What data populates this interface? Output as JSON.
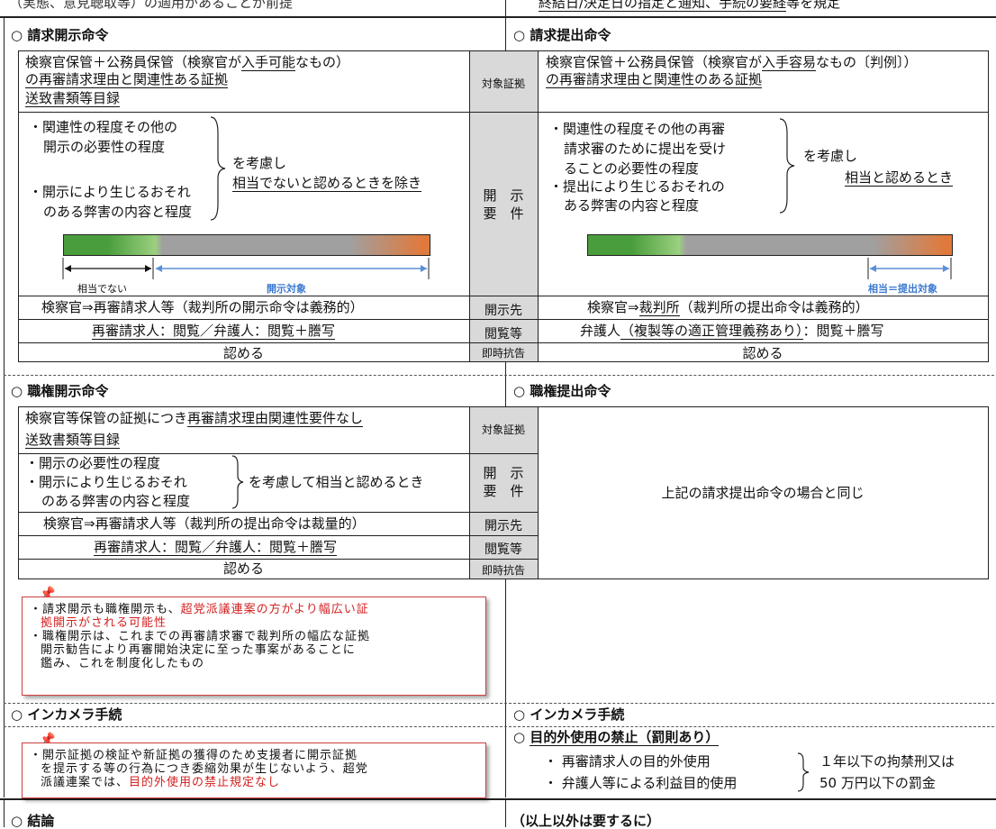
{
  "top_strip": {
    "left": "（実態、意見聴取等）の適用があることが前提",
    "right_a": "終結日/決定日の指定と通知、",
    "right_b": "手続の要経",
    "right_c": "等を規定"
  },
  "sections": {
    "req_disclosure": "請求開示命令",
    "req_submission": "請求提出命令",
    "auth_disclosure": "職権開示命令",
    "auth_submission": "職権提出命令",
    "incamera_left": "インカメラ手続",
    "incamera_right": "インカメラ手続",
    "prohibition": "目的外使用の禁止（罰則あり）",
    "bottom_left": "結論",
    "bottom_right": "（以上以外は要するに）"
  },
  "row_labels": {
    "target": "対象証拠",
    "req_a": "開　示",
    "req_b": "要　件",
    "to": "開示先",
    "view": "閲覧等",
    "appeal": "即時抗告"
  },
  "req_disc": {
    "target_1a": "検察官保管＋公務員保管（検察官が",
    "target_1b": "入手可能",
    "target_1c": "なもの）",
    "target_2": "の再審請求理由と関連性ある証拠",
    "target_3": "送致書類等目録",
    "cond_1": "・関連性の程度その他の",
    "cond_2": "開示の必要性の程度",
    "cond_3": "・開示により生じるおそれ",
    "cond_4": "のある弊害の内容と程度",
    "consider": "を考慮し",
    "except": "相当でないと認めるときを除き",
    "bar_left": "相当でない",
    "bar_right": "開示対象",
    "to": "検察官⇒再審請求人等（裁判所の開示命令は義務的）",
    "view_a": "再審請求人：閲覧／弁護人：閲覧＋謄写",
    "appeal": "認める"
  },
  "req_sub": {
    "target_1a": "検察官保管＋公務員保管（検察官が",
    "target_1b": "入手容易",
    "target_1c": "なもの〔判例〕）",
    "target_2": "の再審請求理由と関連性のある証拠",
    "cond_1": "・関連性の程度その他の再審",
    "cond_2": "請求審のために提出を受け",
    "cond_3": "ることの必要性の程度",
    "cond_4": "・提出により生じるおそれの",
    "cond_5": "ある弊害の内容と程度",
    "consider": "を考慮し",
    "when": "相当と認めるとき",
    "bar_right": "相当＝提出対象",
    "to_a": "検察官⇒",
    "to_b": "裁判所",
    "to_c": "（裁判所の提出命令は義務的）",
    "view_a": "弁護人",
    "view_b": "（複製等の適正管理義務あり）",
    "view_c": "：閲覧＋謄写",
    "appeal": "認める"
  },
  "auth_disc": {
    "target_1a": "検察官等保管の証拠につき",
    "target_1b": "再審請求理由関連性要件なし",
    "target_2": "送致書類等目録",
    "cond_1": "・開示の必要性の程度",
    "cond_2": "・開示により生じるおそれ",
    "cond_3": "のある弊害の内容と程度",
    "consider": "を考慮して相当と認めるとき",
    "to": "検察官⇒再審請求人等（裁判所の提出命令は裁量的）",
    "view": "再審請求人：閲覧／弁護人：閲覧＋謄写",
    "appeal": "認める"
  },
  "auth_sub": {
    "same": "上記の請求提出命令の場合と同じ"
  },
  "note1": {
    "l1a": "・請求開示も職権開示も、",
    "l1b": "超党派議連案の方がより幅広い証",
    "l2": "拠開示がされる可能性",
    "l3": "・職権開示は、これまでの再審請求審で裁判所の幅広な証拠",
    "l4": "開示勧告により再審開始決定に至った事案があることに",
    "l5": "鑑み、これを制度化したもの"
  },
  "note2": {
    "l1": "・開示証拠の検証や新証拠の獲得のため支援者に開示証拠",
    "l2": "を提示する等の行為につき委縮効果が生じないよう、超党",
    "l3a": "派議連案では、",
    "l3b": "目的外使用の禁止規定なし"
  },
  "prohibition": {
    "item1": "・ 再審請求人の目的外使用",
    "item2": "・ 弁護人等による利益目的使用",
    "penalty1": "１年以下の拘禁刑又は",
    "penalty2": "50 万円以下の罰金"
  },
  "colors": {
    "green": "#4a9d3c",
    "orange": "#e07a3c",
    "gray": "#a0a0a0",
    "arrow": "#5b8fd6",
    "red": "#d42020"
  }
}
